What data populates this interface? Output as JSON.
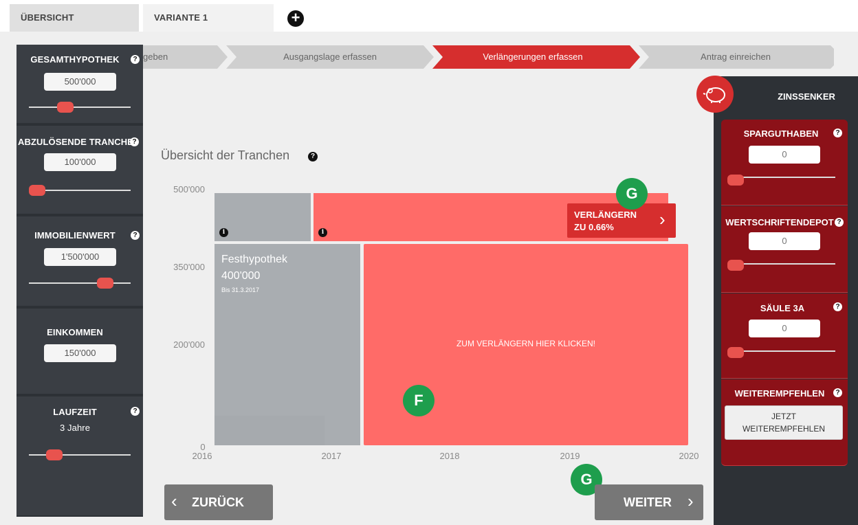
{
  "tabs": {
    "overview": "ÜBERSICHT",
    "variant1": "VARIANTE 1",
    "add_icon": "+"
  },
  "steps": [
    "Eckdaten angeben",
    "Ausgangslage erfassen",
    "Verlängerungen erfassen",
    "Antrag einreichen"
  ],
  "active_step": 2,
  "left_panel": {
    "gesamthypothek": {
      "label": "GESAMTHYPOTHEK",
      "value": "500'000",
      "slider": 0.33
    },
    "abzuloesende": {
      "label": "ABZULÖSENDE TRANCHE",
      "value": "100'000",
      "slider": 0.0
    },
    "immobilienwert": {
      "label": "IMMOBILIENWERT",
      "value": "1'500'000",
      "slider": 0.8
    },
    "einkommen": {
      "label": "EINKOMMEN",
      "value": "150'000"
    },
    "laufzeit": {
      "label": "LAUFZEIT",
      "value": "3 Jahre",
      "slider": 0.2
    },
    "help": "?"
  },
  "chart": {
    "title": "Übersicht der Tranchen",
    "help": "?",
    "y_ticks": [
      "500'000",
      "350'000",
      "200'000",
      "0"
    ],
    "x_ticks": [
      "2016",
      "2017",
      "2018",
      "2019",
      "2020"
    ],
    "tranche_label": "Festhypothek",
    "tranche_amount": "400'000",
    "tranche_until": "Bis 31.3.2017",
    "click_text": "ZUM VERLÄNGERN HIER KLICKEN!",
    "info_icon": "i",
    "extend_line1": "VERLÄNGERN",
    "extend_line2": "ZU 0.66%",
    "extend_chevron": "›"
  },
  "chart_data": {
    "type": "table",
    "title": "Übersicht der Tranchen",
    "x_range": [
      2016,
      2020
    ],
    "y_range": [
      0,
      500000
    ],
    "tranches": [
      {
        "label": "",
        "amount": 100000,
        "start": 2016,
        "end": 2016.85,
        "status": "fixed"
      },
      {
        "label": "",
        "amount": 100000,
        "start": 2016.85,
        "end": 2019.9,
        "status": "extension"
      },
      {
        "label": "Festhypothek",
        "amount": 400000,
        "start": 2016,
        "end": 2017.25,
        "until": "Bis 31.3.2017",
        "status": "fixed"
      },
      {
        "label": "",
        "amount": 400000,
        "start": 2017.25,
        "end": 2020,
        "status": "extension"
      }
    ]
  },
  "nav": {
    "back": "ZURÜCK",
    "next": "WEITER",
    "back_chev": "‹",
    "next_chev": "›"
  },
  "right_panel": {
    "title": "ZINSSENKER",
    "sparguthaben": {
      "label": "SPARGUTHABEN",
      "value": "0"
    },
    "wertschriften": {
      "label": "WERTSCHRIFTENDEPOT",
      "value": "0"
    },
    "saeule": {
      "label": "SÄULE 3A",
      "value": "0"
    },
    "weiterempfehlen": {
      "label": "WEITEREMPFEHLEN",
      "button_line1": "JETZT",
      "button_line2": "WEITEREMPFEHLEN"
    },
    "help": "?"
  },
  "markers": {
    "g": "G",
    "f": "F"
  },
  "colors": {
    "accent": "#d62e2e",
    "tranche_red": "#ff6b68",
    "tranche_grey": "#a9adb1",
    "panel_dark": "#2d3136",
    "panel_red": "#8c1118",
    "marker_green": "#1e9e4d"
  }
}
